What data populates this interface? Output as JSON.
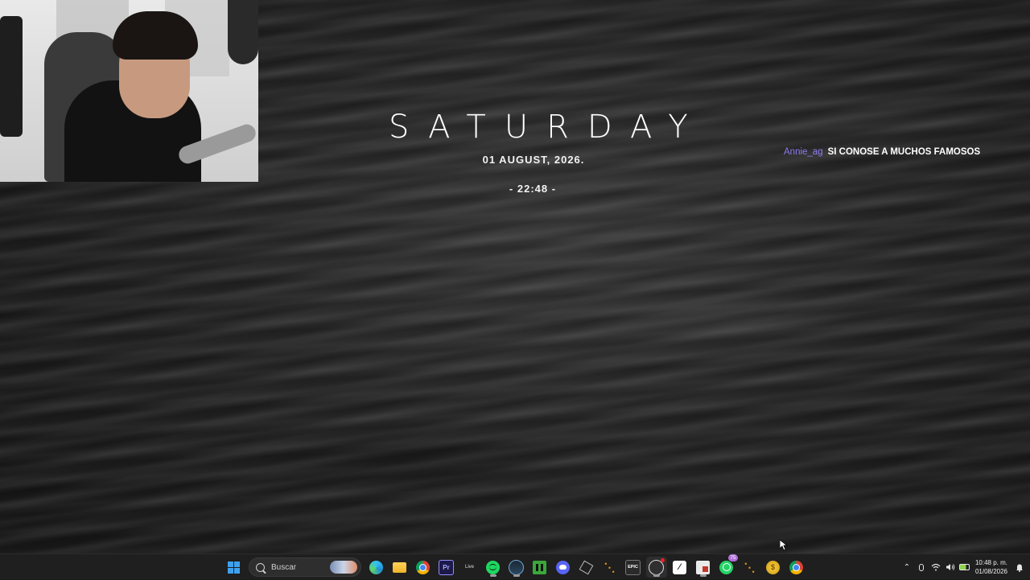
{
  "widget": {
    "day": "SATURDAY",
    "date": "01 AUGUST, 2026.",
    "time": "- 22:48 -"
  },
  "chat": {
    "username": "Annie_ag",
    "message": "SI CONOSE A MUCHOS FAMOSOS",
    "username_color": "#8f7df0"
  },
  "taskbar": {
    "search_placeholder": "Buscar",
    "apps": [
      {
        "name": "Microsoft Edge",
        "icon": "edge-icon"
      },
      {
        "name": "File Explorer",
        "icon": "folder-icon"
      },
      {
        "name": "Google Chrome",
        "icon": "chrome-icon"
      },
      {
        "name": "Adobe Premiere Pro",
        "icon": "premiere-icon",
        "label": "Pr"
      },
      {
        "name": "Live",
        "icon": "live-icon",
        "label": "Live"
      },
      {
        "name": "Spotify",
        "icon": "spotify-icon"
      },
      {
        "name": "Steam",
        "icon": "steam-icon"
      },
      {
        "name": "Minecraft",
        "icon": "minecraft-icon"
      },
      {
        "name": "Discord",
        "icon": "discord-icon"
      },
      {
        "name": "Unity Hub",
        "icon": "unity-icon"
      },
      {
        "name": "App",
        "icon": "app-orange-icon"
      },
      {
        "name": "Epic Games",
        "icon": "epic-icon",
        "label": "EPIC"
      },
      {
        "name": "OBS Studio",
        "icon": "obs-icon"
      },
      {
        "name": "Pencil App",
        "icon": "pencil-icon"
      },
      {
        "name": "Notes App",
        "icon": "notes-icon"
      },
      {
        "name": "WhatsApp",
        "icon": "whatsapp-icon",
        "badge": "75"
      },
      {
        "name": "App",
        "icon": "app-orange2-icon"
      },
      {
        "name": "Coin App",
        "icon": "coin-icon"
      },
      {
        "name": "Google Chrome",
        "icon": "chrome2-icon"
      }
    ],
    "clock_time": "10:48 p. m.",
    "clock_date": "01/08/2026"
  },
  "colors": {
    "accent_blue": "#3ea1f0",
    "taskbar_bg": "#1f1f1f"
  }
}
